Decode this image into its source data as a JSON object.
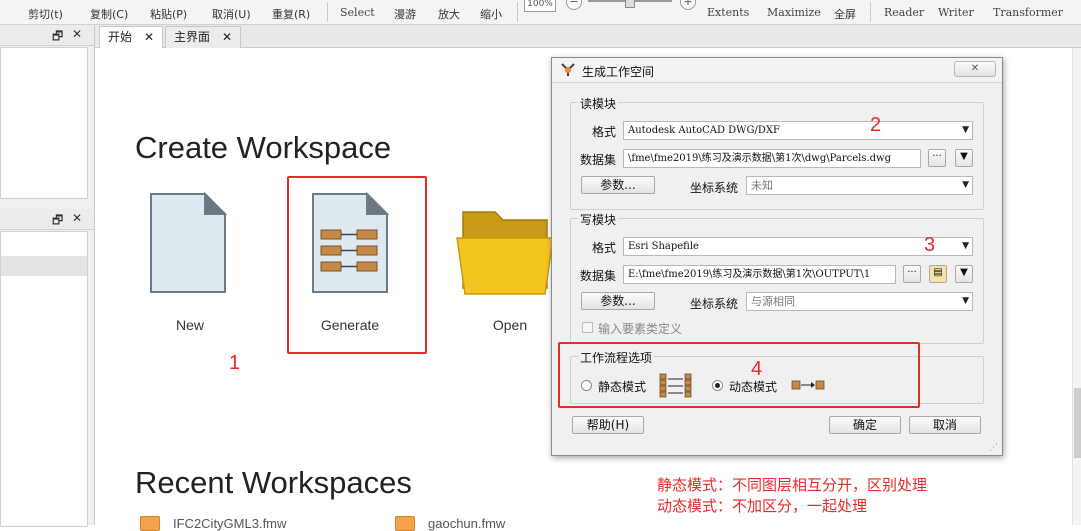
{
  "toolbar": {
    "cut": "剪切(t)",
    "copy": "复制(C)",
    "paste": "粘贴(P)",
    "undo": "取消(U)",
    "redo": "重复(R)",
    "select": "Select",
    "pan": "漫游",
    "zoom_in": "放大",
    "zoom_out": "缩小",
    "zoom_level": "100%",
    "extents": "Extents",
    "maximize": "Maximize",
    "fullscreen": "全屏",
    "reader": "Reader",
    "writer": "Writer",
    "transformer": "Transformer"
  },
  "tabs": [
    {
      "label": "开始",
      "active": true
    },
    {
      "label": "主界面",
      "active": false
    }
  ],
  "start": {
    "create_title": "Create Workspace",
    "tiles": {
      "new": "New",
      "generate": "Generate",
      "open": "Open"
    },
    "recent_title": "Recent Workspaces",
    "recent_items": [
      "IFC2CityGML3.fmw",
      "gaochun.fmw"
    ]
  },
  "annotations": {
    "n1": "1",
    "n2": "2",
    "n3": "3",
    "n4": "4",
    "note_static": "静态模式：不同图层相互分开，区别处理",
    "note_dynamic": "动态模式：不加区分，一起处理"
  },
  "dialog": {
    "title": "生成工作空间",
    "close_glyph": "✕",
    "reader": {
      "group_title": "读模块",
      "format_label": "格式",
      "format_value": "Autodesk AutoCAD DWG/DXF",
      "dataset_label": "数据集",
      "dataset_value": "\\fme\\fme2019\\练习及演示数据\\第1次\\dwg\\Parcels.dwg",
      "params_button": "参数...",
      "coord_label": "坐标系统",
      "coord_value": "未知"
    },
    "writer": {
      "group_title": "写模块",
      "format_label": "格式",
      "format_value": "Esri Shapefile",
      "dataset_label": "数据集",
      "dataset_value": "E:\\fme\\fme2019\\练习及演示数据\\第1次\\OUTPUT\\1",
      "params_button": "参数...",
      "coord_label": "坐标系统",
      "coord_value": "与源相同",
      "feature_def_label": "输入要素类定义"
    },
    "workflow": {
      "group_title": "工作流程选项",
      "static_label": "静态模式",
      "dynamic_label": "动态模式",
      "selected": "dynamic"
    },
    "help_button": "帮助(H)",
    "ok_button": "确定",
    "cancel_button": "取消"
  },
  "colors": {
    "annotation_red": "#e52a2a",
    "folder_yellow": "#f5c51f",
    "doc_blue": "#dde8ef"
  }
}
